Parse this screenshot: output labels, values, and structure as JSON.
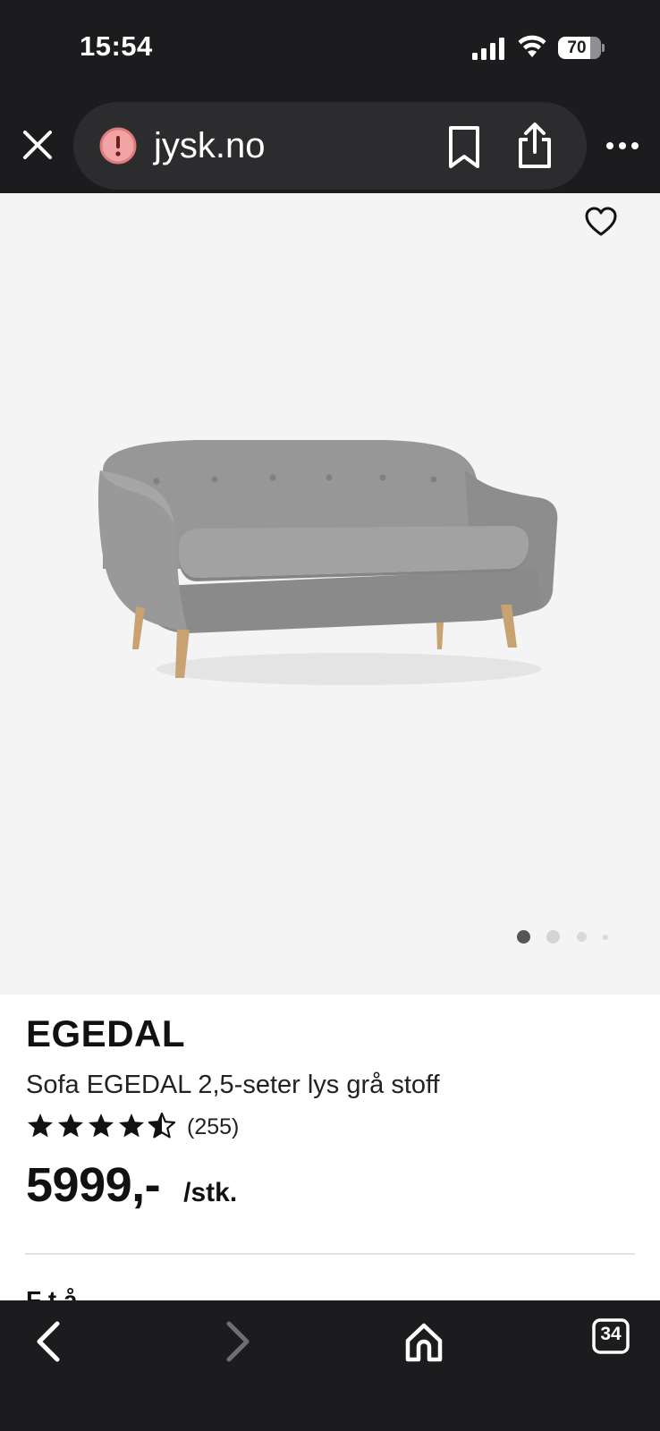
{
  "status_bar": {
    "time": "15:54",
    "battery_level": "70",
    "signal_icon": "cellular-signal-icon",
    "wifi_icon": "wifi-icon",
    "battery_icon": "battery-icon"
  },
  "browser": {
    "url": "jysk.no",
    "close_icon": "close-icon",
    "security_icon": "warning-icon",
    "bookmark_icon": "bookmark-icon",
    "share_icon": "share-icon",
    "more_icon": "more-icon"
  },
  "product": {
    "image_alt": "sofa-image",
    "favorite_icon": "heart-icon",
    "gallery": {
      "total_images": 4,
      "active_index": 0
    },
    "brand": "EGEDAL",
    "name": "Sofa EGEDAL 2,5-seter lys grå stoff",
    "rating": 4.5,
    "rating_max": 5,
    "review_count": "(255)",
    "price": "5999,-",
    "unit": "/stk.",
    "next_section_partial": "F      t      å"
  },
  "toolbar": {
    "back_icon": "back-arrow-icon",
    "forward_icon": "forward-arrow-icon",
    "home_icon": "home-icon",
    "tabs_icon": "tabs-icon",
    "tabs_count": "34"
  },
  "colors": {
    "chrome_bg": "#1c1c1e",
    "url_pill_bg": "#2c2c2e",
    "gallery_bg": "#f4f4f4",
    "warning_pink": "#f2a4a4",
    "text_primary": "#111111"
  }
}
